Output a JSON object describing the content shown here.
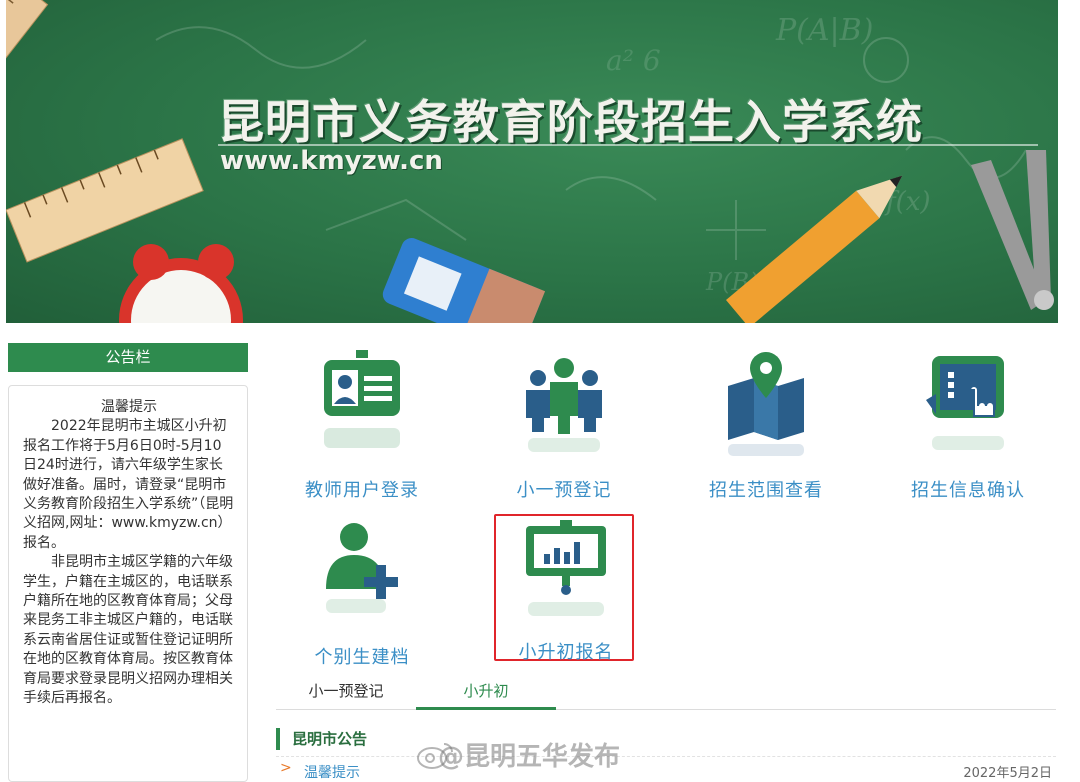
{
  "banner": {
    "title": "昆明市义务教育阶段招生入学系统",
    "url": "www.kmyzw.cn"
  },
  "notice": {
    "header": "公告栏",
    "title": "温馨提示",
    "paragraphs": [
      "2022年昆明市主城区小升初报名工作将于5月6日0时-5月10日24时进行，请六年级学生家长做好准备。届时，请登录“昆明市义务教育阶段招生入学系统”（昆明义招网,网址：www.kmyzw.cn）报名。",
      "非昆明市主城区学籍的六年级学生，户籍在主城区的，电话联系户籍所在地的区教育体育局；父母来昆务工非主城区户籍的，电话联系云南省居住证或暂住登记证明所在地的区教育体育局。按区教育体育局要求登录昆明义招网办理相关手续后再报名。"
    ]
  },
  "tiles": [
    {
      "label": "教师用户登录",
      "icon": "id-card-icon"
    },
    {
      "label": "小一预登记",
      "icon": "group-icon"
    },
    {
      "label": "招生范围查看",
      "icon": "map-pin-icon"
    },
    {
      "label": "招生信息确认",
      "icon": "tablet-touch-icon"
    },
    {
      "label": "个别生建档",
      "icon": "add-user-icon"
    },
    {
      "label": "小升初报名",
      "icon": "presentation-chart-icon"
    }
  ],
  "tabs": [
    {
      "label": "小一预登记",
      "active": false
    },
    {
      "label": "小升初",
      "active": true
    }
  ],
  "announcements": {
    "title": "昆明市公告",
    "items": [
      {
        "text": "温馨提示",
        "date": "2022年5月2日"
      }
    ]
  },
  "watermark": "@昆明五华发布",
  "colors": {
    "brand_green": "#2e8b4e",
    "link_blue": "#3b8fc6",
    "highlight_red": "#e0252b"
  }
}
